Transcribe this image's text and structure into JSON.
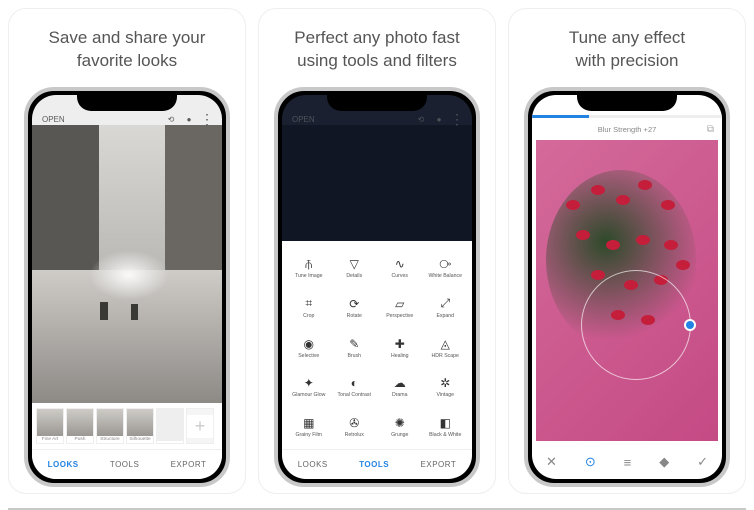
{
  "slides": [
    {
      "caption_l1": "Save and share your",
      "caption_l2": "favorite looks"
    },
    {
      "caption_l1": "Perfect any photo fast",
      "caption_l2": "using tools and filters"
    },
    {
      "caption_l1": "Tune any effect",
      "caption_l2": "with precision"
    }
  ],
  "screen1": {
    "open_label": "OPEN",
    "thumbs": [
      {
        "label": "Fine Art"
      },
      {
        "label": "Push"
      },
      {
        "label": "Structure"
      },
      {
        "label": "Silhouette"
      }
    ],
    "add_thumb_glyph": "+",
    "tabs": {
      "looks": "LOOKS",
      "tools": "TOOLS",
      "export": "EXPORT",
      "active": "looks"
    }
  },
  "screen2": {
    "open_label": "OPEN",
    "tabs": {
      "looks": "LOOKS",
      "tools": "TOOLS",
      "export": "EXPORT",
      "active": "tools"
    },
    "tools": [
      {
        "name": "tune-image",
        "label": "Tune Image"
      },
      {
        "name": "details",
        "label": "Details"
      },
      {
        "name": "curves",
        "label": "Curves"
      },
      {
        "name": "white-balance",
        "label": "White Balance"
      },
      {
        "name": "crop",
        "label": "Crop"
      },
      {
        "name": "rotate",
        "label": "Rotate"
      },
      {
        "name": "perspective",
        "label": "Perspective"
      },
      {
        "name": "expand",
        "label": "Expand"
      },
      {
        "name": "selective",
        "label": "Selective"
      },
      {
        "name": "brush",
        "label": "Brush"
      },
      {
        "name": "healing",
        "label": "Healing"
      },
      {
        "name": "hdr-scape",
        "label": "HDR Scape"
      },
      {
        "name": "glamour-glow",
        "label": "Glamour Glow"
      },
      {
        "name": "tonal-contrast",
        "label": "Tonal Contrast"
      },
      {
        "name": "drama",
        "label": "Drama"
      },
      {
        "name": "vintage",
        "label": "Vintage"
      },
      {
        "name": "grainy-film",
        "label": "Grainy Film"
      },
      {
        "name": "retrolux",
        "label": "Retrolux"
      },
      {
        "name": "grunge",
        "label": "Grunge"
      },
      {
        "name": "black-white",
        "label": "Black & White"
      }
    ]
  },
  "screen3": {
    "slider_label": "Blur Strength +27",
    "progress_percent": 30,
    "bottom": {
      "close": "✕",
      "target": "⊙",
      "adjust": "≡",
      "style": "◆",
      "apply": "✓"
    }
  },
  "tool_glyphs": {
    "tune-image": "⫚",
    "details": "▽",
    "curves": "∿",
    "white-balance": "⧂",
    "crop": "⌗",
    "rotate": "⟳",
    "perspective": "▱",
    "expand": "⤢",
    "selective": "◉",
    "brush": "✎",
    "healing": "✚",
    "hdr-scape": "◬",
    "glamour-glow": "✦",
    "tonal-contrast": "◐",
    "drama": "☁",
    "vintage": "✲",
    "grainy-film": "▦",
    "retrolux": "✇",
    "grunge": "✺",
    "black-white": "◧"
  }
}
